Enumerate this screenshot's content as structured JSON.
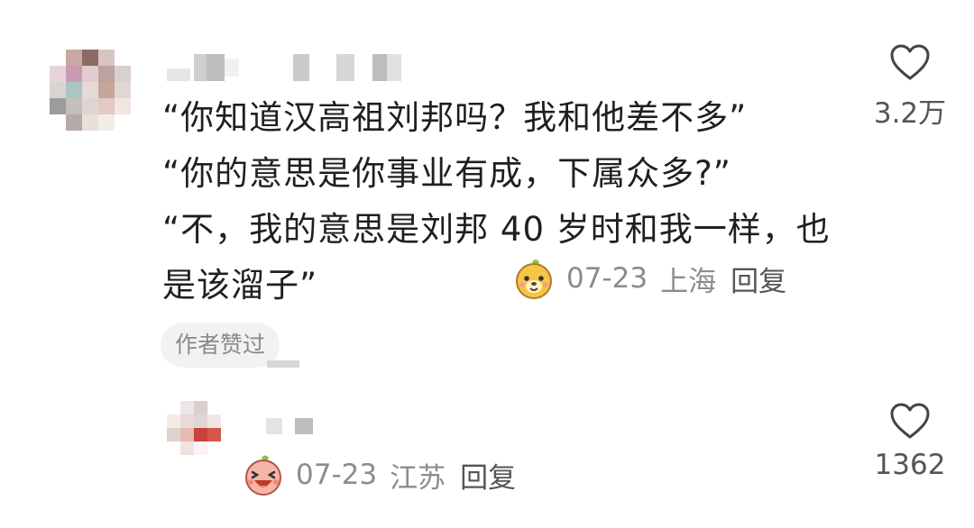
{
  "comments": [
    {
      "lines": [
        "“你知道汉高祖刘邦吗？我和他差不多”",
        "“你的意思是你事业有成，下属众多?”",
        "“不，我的意思是刘邦 40 岁时和我一样，也",
        "是该溜子”"
      ],
      "date": "07-23",
      "region": "上海",
      "reply_label": "回复",
      "badge": "作者赞过",
      "like_count": "3.2万",
      "like_icon": "heart-outline-icon",
      "emoji": "yellow-bear-emoji"
    },
    {
      "date": "07-23",
      "region": "江苏",
      "reply_label": "回复",
      "like_count": "1362",
      "like_icon": "heart-outline-icon",
      "emoji": "pink-laughing-emoji"
    }
  ],
  "colors": {
    "meta_text": "#8c8c8c",
    "badge_bg": "#f2f2f2"
  }
}
